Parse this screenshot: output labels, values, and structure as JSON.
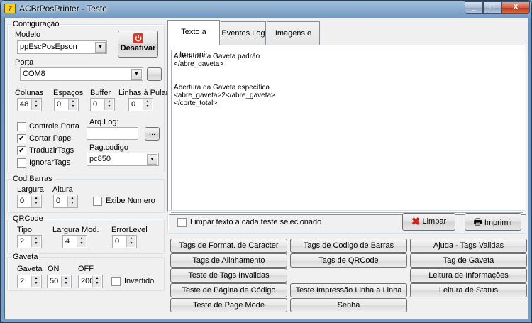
{
  "window": {
    "title": "ACBrPosPrinter - Teste",
    "icon_text": "7",
    "min_glyph": "_",
    "max_glyph": "□",
    "close_glyph": "X"
  },
  "config": {
    "group_title": "Configuração",
    "modelo_label": "Modelo",
    "modelo_value": "ppEscPosEpson",
    "desativar_label": "Desativar",
    "porta_label": "Porta",
    "porta_value": "COM8",
    "colunas_label": "Colunas",
    "colunas_value": "48",
    "espacos_label": "Espaços",
    "espacos_value": "0",
    "buffer_label": "Buffer",
    "buffer_value": "0",
    "linhas_label": "Linhas à Pular",
    "linhas_value": "0",
    "controle_porta_label": "Controle Porta",
    "controle_porta_checked": false,
    "cortar_papel_label": "Cortar Papel",
    "cortar_papel_checked": true,
    "traduzir_tags_label": "TraduzirTags",
    "traduzir_tags_checked": true,
    "ignorar_tags_label": "IgnorarTags",
    "ignorar_tags_checked": false,
    "arqlog_label": "Arq.Log:",
    "arqlog_value": "",
    "browse_label": "...",
    "pagcodigo_label": "Pag.codigo",
    "pagcodigo_value": "pc850"
  },
  "codbarras": {
    "group_title": "Cod.Barras",
    "largura_label": "Largura",
    "largura_value": "0",
    "altura_label": "Altura",
    "altura_value": "0",
    "exibe_label": "Exibe Numero",
    "exibe_checked": false
  },
  "qrcode": {
    "group_title": "QRCode",
    "tipo_label": "Tipo",
    "tipo_value": "2",
    "largura_label": "Largura Mod.",
    "largura_value": "4",
    "error_label": "ErrorLevel",
    "error_value": "0"
  },
  "gaveta": {
    "group_title": "Gaveta",
    "gaveta_label": "Gaveta",
    "gaveta_value": "2",
    "on_label": "ON",
    "on_value": "50",
    "off_label": "OFF",
    "off_value": "200",
    "invertido_label": "Invertido",
    "invertido_checked": false
  },
  "tabs": [
    {
      "label": "Texto a Imprimir",
      "active": true
    },
    {
      "label": "Eventos Log",
      "active": false
    },
    {
      "label": "Imagens e Logo",
      "active": false
    }
  ],
  "memo_text": "Abertura da Gaveta padrão\n</abre_gaveta>\n\n\nAbertura da Gaveta específica\n<abre_gaveta>2</abre_gaveta>\n</corte_total>",
  "limpar_texto_label": "Limpar texto a cada teste selecionado",
  "limpar_texto_checked": false,
  "limpar_label": "Limpar",
  "imprimir_label": "Imprimir",
  "buttons": {
    "col1": [
      "Tags de Format. de Caracter",
      "Tags de Alinhamento",
      "Teste de Tags Invalidas",
      "Teste de Página de Código",
      "Teste de Page Mode"
    ],
    "col2": [
      "Tags de Codigo de Barras",
      "Tags de QRCode",
      "",
      "Teste Impressão Linha a Linha",
      "Senha"
    ],
    "col3": [
      "Ajuda - Tags Validas",
      "Tag de Gaveta",
      "Leitura de Informações",
      "Leitura de Status",
      ""
    ]
  },
  "colors": {
    "title_bar": "#7aa0c6",
    "client_bg": "#f0f0f0",
    "close_red": "#c0391b",
    "power_red": "#d9372a"
  }
}
